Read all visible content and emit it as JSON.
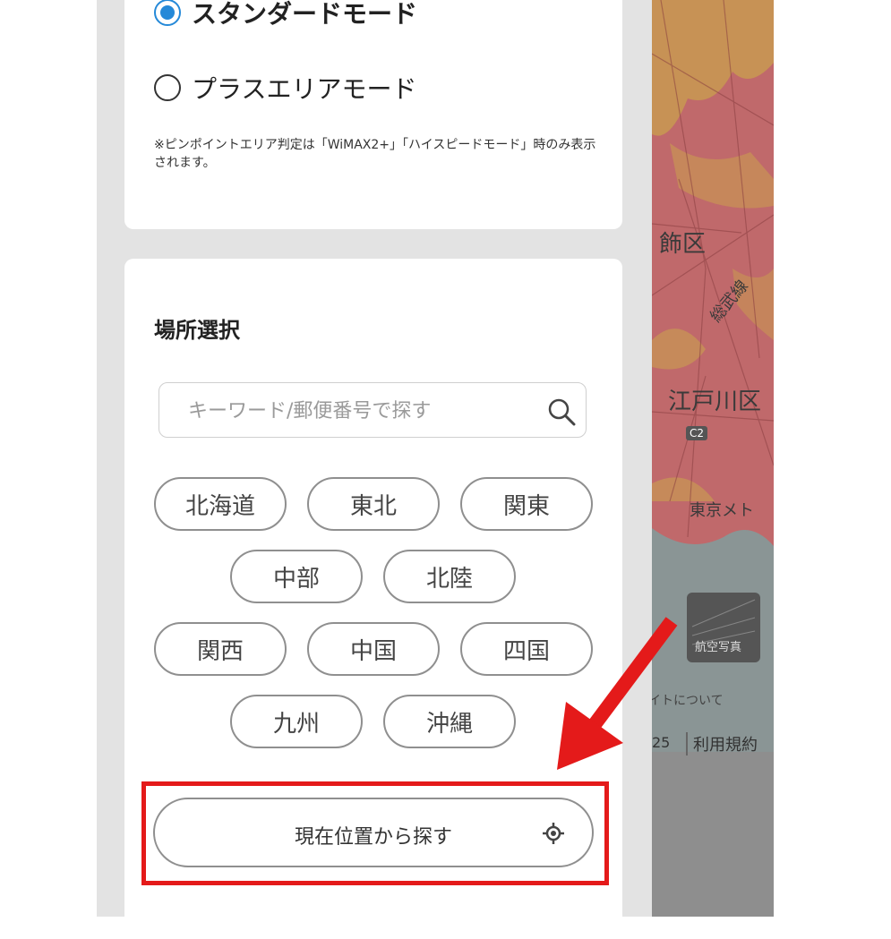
{
  "mode_card": {
    "options": [
      {
        "label": "スタンダードモード",
        "selected": true
      },
      {
        "label": "プラスエリアモード",
        "selected": false
      }
    ],
    "note": "※ピンポイントエリア判定は「WiMAX2+」「ハイスピードモード」時のみ表示されます。"
  },
  "location_card": {
    "title": "場所選択",
    "search": {
      "placeholder": "キーワード/郵便番号で探す",
      "value": "",
      "icon": "search-icon"
    },
    "regions": [
      "北海道",
      "東北",
      "関東",
      "中部",
      "北陸",
      "関西",
      "中国",
      "四国",
      "九州",
      "沖縄"
    ],
    "locate_button": {
      "label": "現在位置から探す",
      "icon": "gps-target-icon"
    }
  },
  "map": {
    "labels": [
      "飾区",
      "総武線",
      "江戸川区",
      "C2",
      "東京メト",
      "航空写真",
      "イトについて",
      "25",
      "利用規約"
    ]
  },
  "colors": {
    "accent_blue": "#2589d8",
    "highlight_red": "#e41a1a",
    "coverage_red": "#c0696b",
    "coverage_yellow": "#caa04e",
    "water": "#8a9595"
  }
}
